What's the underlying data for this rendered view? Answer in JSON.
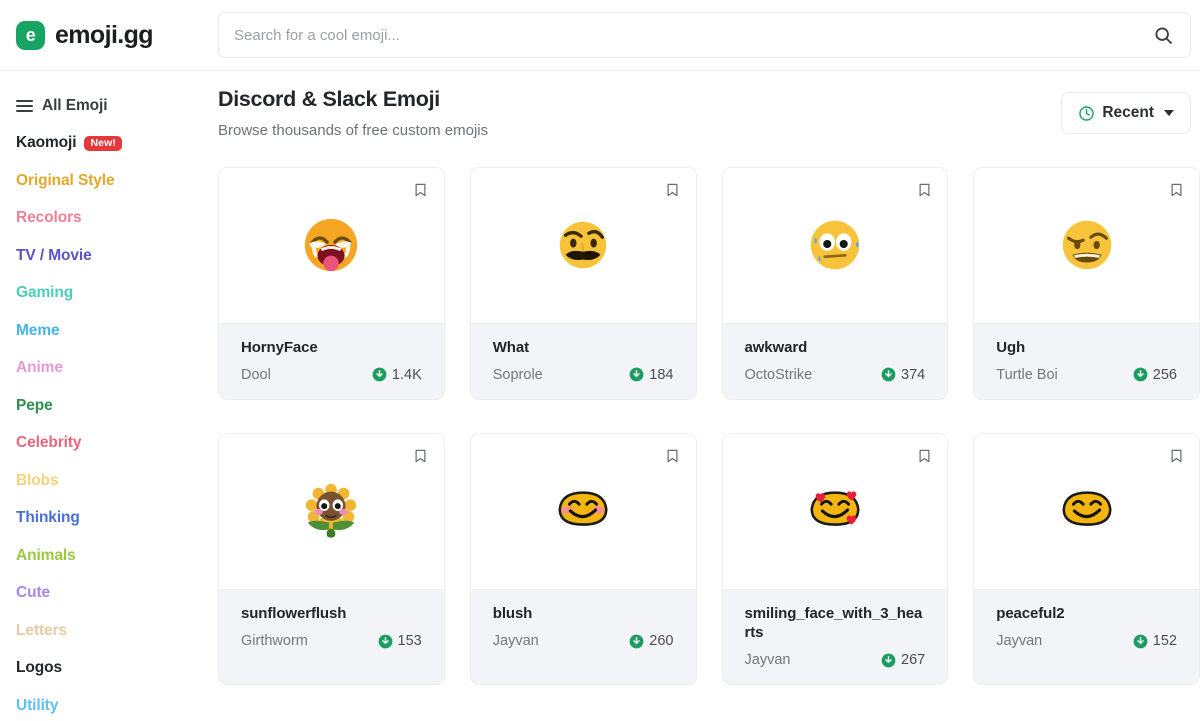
{
  "brand": {
    "logo_letter": "e",
    "name": "emoji.gg",
    "accent_color": "#17a364"
  },
  "search": {
    "placeholder": "Search for a cool emoji...",
    "value": "",
    "icon": "search-icon"
  },
  "sidebar": {
    "items": [
      {
        "label": "All Emoji",
        "color": "#3a3d42",
        "icon": "hamburger-icon",
        "badge": null
      },
      {
        "label": "Kaomoji",
        "color": "#23252a",
        "icon": null,
        "badge": "New!"
      },
      {
        "label": "Original Style",
        "color": "#e0a92a",
        "icon": null,
        "badge": null
      },
      {
        "label": "Recolors",
        "color": "#ef8098",
        "icon": null,
        "badge": null
      },
      {
        "label": "TV / Movie",
        "color": "#5b51c9",
        "icon": null,
        "badge": null
      },
      {
        "label": "Gaming",
        "color": "#4ecdb6",
        "icon": null,
        "badge": null
      },
      {
        "label": "Meme",
        "color": "#45b6e8",
        "icon": null,
        "badge": null
      },
      {
        "label": "Anime",
        "color": "#e59ad6",
        "icon": null,
        "badge": null
      },
      {
        "label": "Pepe",
        "color": "#2f8f4e",
        "icon": null,
        "badge": null
      },
      {
        "label": "Celebrity",
        "color": "#e5687e",
        "icon": null,
        "badge": null
      },
      {
        "label": "Blobs",
        "color": "#f2d27c",
        "icon": null,
        "badge": null
      },
      {
        "label": "Thinking",
        "color": "#4a6fd6",
        "icon": null,
        "badge": null
      },
      {
        "label": "Animals",
        "color": "#9ac93f",
        "icon": null,
        "badge": null
      },
      {
        "label": "Cute",
        "color": "#a887e8",
        "icon": null,
        "badge": null
      },
      {
        "label": "Letters",
        "color": "#e8cba2",
        "icon": null,
        "badge": null
      },
      {
        "label": "Logos",
        "color": "#23252a",
        "icon": null,
        "badge": null
      },
      {
        "label": "Utility",
        "color": "#5fc1ee",
        "icon": null,
        "badge": null
      }
    ]
  },
  "main": {
    "title": "Discord & Slack Emoji",
    "subtitle": "Browse thousands of free custom emojis",
    "sort": {
      "label": "Recent",
      "icon": "clock-icon",
      "icon_color": "#17a364",
      "caret": "chevron-down-icon"
    },
    "cards": [
      {
        "name": "HornyFace",
        "author": "Dool",
        "downloads": "1.4K",
        "art": "horny-face"
      },
      {
        "name": "What",
        "author": "Soprole",
        "downloads": "184",
        "art": "mustache-face"
      },
      {
        "name": "awkward",
        "author": "OctoStrike",
        "downloads": "374",
        "art": "sweat-face"
      },
      {
        "name": "Ugh",
        "author": "Turtle Boi",
        "downloads": "256",
        "art": "ugh-face"
      },
      {
        "name": "sunflowerflush",
        "author": "Girthworm",
        "downloads": "153",
        "art": "sunflower-face"
      },
      {
        "name": "blush",
        "author": "Jayvan",
        "downloads": "260",
        "art": "blush-face"
      },
      {
        "name": "smiling_face_with_3_hearts",
        "author": "Jayvan",
        "downloads": "267",
        "art": "hearts-face"
      },
      {
        "name": "peaceful2",
        "author": "Jayvan",
        "downloads": "152",
        "art": "peaceful-face"
      }
    ],
    "bookmark_icon": "bookmark-icon",
    "download_icon": "download-icon",
    "download_icon_color": "#1a9e5f"
  }
}
